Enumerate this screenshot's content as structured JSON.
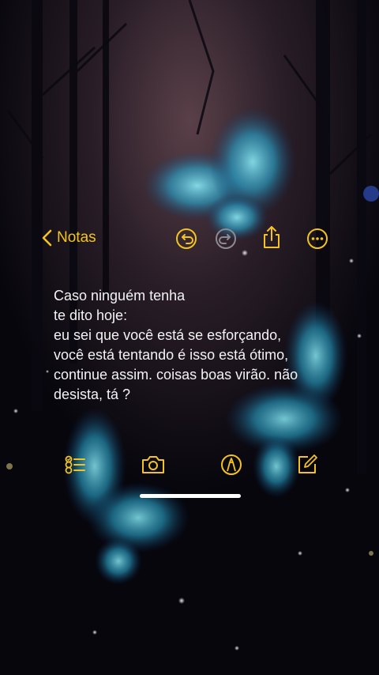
{
  "app": {
    "back_label": "Notas"
  },
  "toolbar_top": {
    "icons": [
      "undo-icon",
      "redo-icon",
      "share-icon",
      "more-icon"
    ],
    "accent": "#f2c321"
  },
  "note": {
    "lines": [
      "Caso ninguém tenha",
      "te dito hoje:",
      "eu sei que você está se esforçando,",
      "você está tentando é isso está ótimo,",
      "continue assim. coisas boas virão. não",
      "desista, tá ?"
    ],
    "text_color": "#f3f3f3"
  },
  "toolbar_bottom": {
    "icons": [
      "checklist-icon",
      "camera-icon",
      "markup-icon",
      "compose-icon"
    ]
  },
  "wallpaper": {
    "theme": "dark forest with glowing blue butterflies",
    "colors": [
      "#06050c",
      "#3a2a33",
      "#4fd3ee"
    ]
  }
}
